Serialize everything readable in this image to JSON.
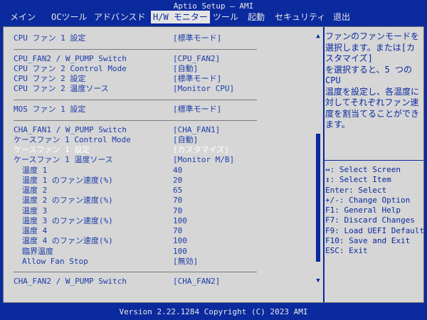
{
  "header": {
    "title": "Aptio Setup – AMI"
  },
  "menu": {
    "tabs": [
      {
        "label": "メイン"
      },
      {
        "label": "OCツール"
      },
      {
        "label": "アドバンスド"
      },
      {
        "label": "H/W モニター"
      },
      {
        "label": "ツール"
      },
      {
        "label": "起動"
      },
      {
        "label": "セキュリティ"
      },
      {
        "label": "退出"
      }
    ],
    "active_tab": "H/W モニター"
  },
  "settings": [
    {
      "label": "CPU ファン 1 設定",
      "value": "[標準モード]"
    },
    {
      "label": "CPU_FAN2 / W_PUMP Switch",
      "value": "[CPU_FAN2]"
    },
    {
      "label": "CPU ファン 2 Control Mode",
      "value": "[自動]"
    },
    {
      "label": "CPU ファン 2 設定",
      "value": "[標準モード]"
    },
    {
      "label": "CPU ファン 2 温度ソース",
      "value": "[Monitor CPU]"
    },
    {
      "label": "MOS ファン 1 設定",
      "value": "[標準モード]"
    },
    {
      "label": "CHA_FAN1 / W_PUMP Switch",
      "value": "[CHA_FAN1]"
    },
    {
      "label": "ケースファン 1 Control Mode",
      "value": "[自動]"
    },
    {
      "label": "ケースファン 1 設定",
      "value": "[カスタマイズ]"
    },
    {
      "label": "ケースファン 1 温度ソース",
      "value": "[Monitor M/B]"
    },
    {
      "label": "温度 1",
      "value": "40"
    },
    {
      "label": "温度 1 のファン速度(%)",
      "value": "20"
    },
    {
      "label": "温度 2",
      "value": "65"
    },
    {
      "label": "温度 2 のファン速度(%)",
      "value": "70"
    },
    {
      "label": "温度 3",
      "value": "70"
    },
    {
      "label": "温度 3 のファン速度(%)",
      "value": "100"
    },
    {
      "label": "温度 4",
      "value": "70"
    },
    {
      "label": "温度 4 のファン速度(%)",
      "value": "100"
    },
    {
      "label": "臨界温度",
      "value": "100"
    },
    {
      "label": "Allow Fan Stop",
      "value": "[無効]"
    },
    {
      "label": "CHA_FAN2 / W_PUMP Switch",
      "value": "[CHA_FAN2]"
    }
  ],
  "help": {
    "text": "ファンのファンモードを選択します。または[カスタマイズ]\nを選択すると、5 つのCPU\n温度を設定し、各温度に対してそれぞれファン速度を割当てることができます。"
  },
  "keys": [
    "↔: Select Screen",
    "↕: Select Item",
    "Enter: Select",
    "+/-: Change Option",
    "F1: General Help",
    "F7: Discard Changes",
    "F9: Load UEFI Defaults",
    "F10: Save and Exit",
    "ESC: Exit"
  ],
  "footer": {
    "version": "Version 2.22.1284 Copyright (C) 2023 AMI"
  },
  "colors": {
    "background": "#0a2a9e",
    "panel": "#d6d6d6",
    "highlight": "#ffffff"
  },
  "icons": [
    "scroll-up-arrow-icon",
    "scroll-down-arrow-icon"
  ]
}
